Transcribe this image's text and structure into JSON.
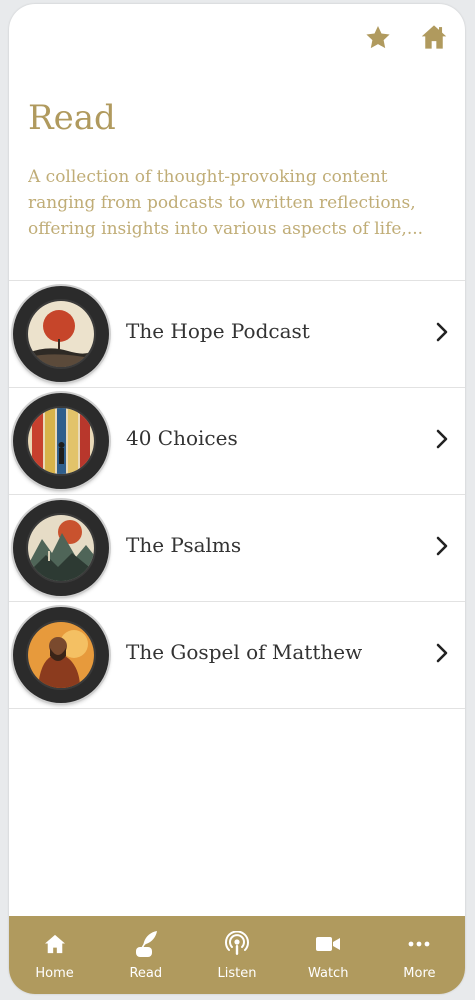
{
  "colors": {
    "accent": "#b09a5e",
    "text": "#333333",
    "background": "#ffffff"
  },
  "header": {
    "title": "Read",
    "description": "A collection of thought-provoking content ranging from podcasts to written reflections, offering insights into various aspects of life,..."
  },
  "topbar": {
    "icons": [
      "star-icon",
      "home-icon"
    ]
  },
  "items": [
    {
      "label": "The Hope Podcast",
      "icon": "hope-podcast-artwork"
    },
    {
      "label": "40 Choices",
      "icon": "forty-choices-artwork"
    },
    {
      "label": "The Psalms",
      "icon": "psalms-artwork"
    },
    {
      "label": "The Gospel of Matthew",
      "icon": "gospel-matthew-artwork"
    }
  ],
  "tabs": [
    {
      "label": "Home",
      "icon": "home-icon"
    },
    {
      "label": "Read",
      "icon": "quill-icon"
    },
    {
      "label": "Listen",
      "icon": "podcast-icon"
    },
    {
      "label": "Watch",
      "icon": "video-icon"
    },
    {
      "label": "More",
      "icon": "more-dots-icon"
    }
  ]
}
